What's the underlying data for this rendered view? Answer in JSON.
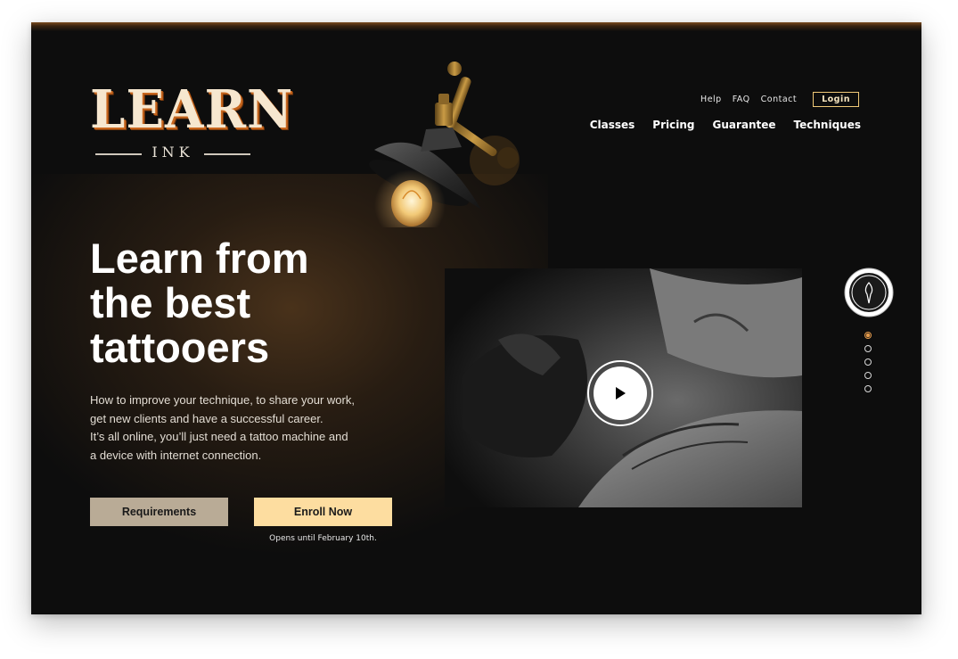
{
  "brand": {
    "logo_word": "LEARN",
    "logo_sub": "INK"
  },
  "util_nav": {
    "help": "Help",
    "faq": "FAQ",
    "contact": "Contact",
    "login": "Login"
  },
  "main_nav": {
    "classes": "Classes",
    "pricing": "Pricing",
    "guarantee": "Guarantee",
    "techniques": "Techniques"
  },
  "hero": {
    "headline_line1": "Learn from",
    "headline_line2": "the best",
    "headline_line3": "tattooers",
    "body_line1": "How to improve your technique, to share your work,",
    "body_line2": "get new clients and have a successful career.",
    "body_line3": "It’s all online, you’ll just need a tattoo machine and",
    "body_line4": "a device with internet connection."
  },
  "actions": {
    "requirements_label": "Requirements",
    "enroll_label": "Enroll Now",
    "enroll_note": "Opens until February 10th."
  },
  "video": {
    "play_icon": "play-icon"
  },
  "side": {
    "badge_icon": "tattoo-needle-icon",
    "pager_count": 5,
    "active_index": 0
  },
  "colors": {
    "background": "#0d0d0d",
    "accent_gold": "#fddda0",
    "accent_orange": "#e39a4c",
    "secondary_button": "#b9ab96",
    "logo_shadow": "#c7651c"
  }
}
